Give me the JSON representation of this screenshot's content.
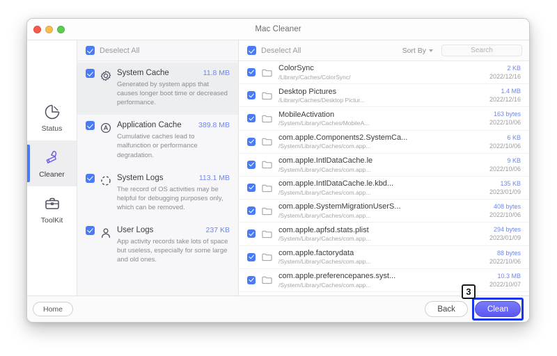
{
  "window": {
    "title": "Mac Cleaner",
    "traffic_lights": [
      "close-red",
      "minimize-yellow",
      "zoom-green"
    ]
  },
  "sidebar": {
    "items": [
      {
        "label": "Status",
        "icon": "pie-chart-icon",
        "active": false
      },
      {
        "label": "Cleaner",
        "icon": "brush-icon",
        "active": true
      },
      {
        "label": "ToolKit",
        "icon": "briefcase-icon",
        "active": false
      }
    ]
  },
  "categories_panel": {
    "deselect_all_label": "Deselect All",
    "items": [
      {
        "name": "System Cache",
        "size": "11.8 MB",
        "description": "Generated by system apps that causes longer boot time or decreased performance.",
        "icon": "gear-icon",
        "checked": true,
        "selected": true
      },
      {
        "name": "Application Cache",
        "size": "389.8 MB",
        "description": "Cumulative caches lead to malfunction or performance degradation.",
        "icon": "circled-a-icon",
        "checked": true,
        "selected": false
      },
      {
        "name": "System Logs",
        "size": "113.1 MB",
        "description": "The record of OS activities may be helpful for debugging purposes only, which can be removed.",
        "icon": "dashed-circle-icon",
        "checked": true,
        "selected": false
      },
      {
        "name": "User Logs",
        "size": "237 KB",
        "description": "App activity records take lots of space but useless, especially for some large and old ones.",
        "icon": "person-icon",
        "checked": true,
        "selected": false
      }
    ]
  },
  "file_panel": {
    "deselect_all_label": "Deselect All",
    "sort_by_label": "Sort By",
    "search_placeholder": "Search",
    "rows": [
      {
        "name": "ColorSync",
        "path": "/Library/Caches/ColorSync/",
        "size": "2 KB",
        "date": "2022/12/16",
        "checked": true
      },
      {
        "name": "Desktop Pictures",
        "path": "/Library/Caches/Desktop Pictur...",
        "size": "1.4 MB",
        "date": "2022/12/16",
        "checked": true
      },
      {
        "name": "MobileActivation",
        "path": "/System/Library/Caches/MobileA...",
        "size": "163 bytes",
        "date": "2022/10/06",
        "checked": true
      },
      {
        "name": "com.apple.Components2.SystemCa...",
        "path": "/System/Library/Caches/com.app...",
        "size": "6 KB",
        "date": "2022/10/06",
        "checked": true
      },
      {
        "name": "com.apple.IntlDataCache.le",
        "path": "/System/Library/Caches/com.app...",
        "size": "9 KB",
        "date": "2022/10/06",
        "checked": true
      },
      {
        "name": "com.apple.IntlDataCache.le.kbd...",
        "path": "/System/Library/Caches/com.app...",
        "size": "135 KB",
        "date": "2023/01/09",
        "checked": true
      },
      {
        "name": "com.apple.SystemMigrationUserS...",
        "path": "/System/Library/Caches/com.app...",
        "size": "408 bytes",
        "date": "2022/10/06",
        "checked": true
      },
      {
        "name": "com.apple.apfsd.stats.plist",
        "path": "/System/Library/Caches/com.app...",
        "size": "294 bytes",
        "date": "2023/01/09",
        "checked": true
      },
      {
        "name": "com.apple.factorydata",
        "path": "/System/Library/Caches/com.app...",
        "size": "88 bytes",
        "date": "2022/10/06",
        "checked": true
      },
      {
        "name": "com.apple.preferencepanes.syst...",
        "path": "/System/Library/Caches/com.app...",
        "size": "10.3 MB",
        "date": "2022/10/07",
        "checked": true
      }
    ]
  },
  "footer": {
    "home_label": "Home",
    "back_label": "Back",
    "clean_label": "Clean"
  },
  "annotation": {
    "step_number": "3",
    "highlight_color": "#1636e8",
    "target": "clean-button"
  },
  "colors": {
    "accent_blue": "#4a7bf7",
    "size_text": "#6d86f0",
    "clean_button": "#5a57ef",
    "sidebar_active_bar": "#4a7bf7"
  }
}
